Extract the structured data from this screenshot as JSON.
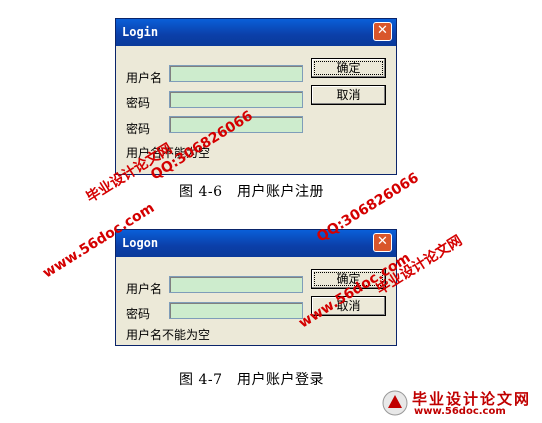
{
  "register_dialog": {
    "title": "Login",
    "close_glyph": "✕",
    "username_label": "用户名",
    "password_label": "密码",
    "confirm_password_label": "密码",
    "confirm_button": "确定",
    "cancel_button": "取消",
    "error_text": "用户名不能为空"
  },
  "register_caption": "图 4-6　用户账户注册",
  "login_dialog": {
    "title": "Logon",
    "close_glyph": "✕",
    "username_label": "用户名",
    "password_label": "密码",
    "confirm_button": "确定",
    "cancel_button": "取消",
    "error_text": "用户名不能为空"
  },
  "login_caption": "图 4-7　用户账户登录",
  "watermarks": {
    "site_name": "毕业设计论文网",
    "site_url": "www.56doc.com",
    "qq": "QQ:306826066"
  },
  "logo": {
    "name": "毕业设计论文网",
    "url": "www.56doc.com"
  },
  "colors": {
    "titlebar": "#0b3fa8",
    "field_bg": "#cdeccd",
    "window_bg": "#ece9d8",
    "close_button": "#d9562b",
    "watermark": "#d40000"
  }
}
